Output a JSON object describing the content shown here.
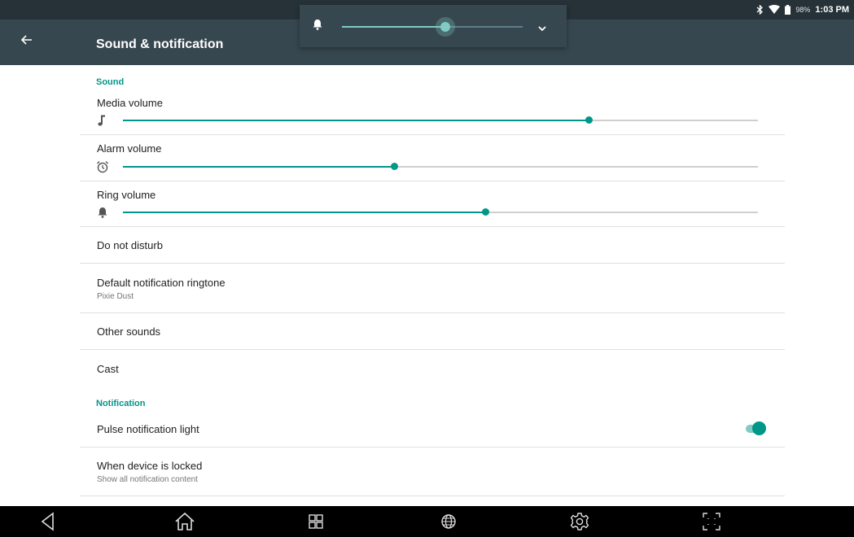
{
  "status_bar": {
    "battery": "98%",
    "time": "1:03 PM",
    "icons": [
      "bluetooth-icon",
      "wifi-icon",
      "battery-icon"
    ]
  },
  "app_bar": {
    "title": "Sound & notification",
    "back_icon": "arrow-left-icon"
  },
  "volume_panel": {
    "icon": "bell-icon",
    "level": 0.57,
    "expand_icon": "chevron-down-icon"
  },
  "sections": {
    "sound": "Sound",
    "notification": "Notification"
  },
  "sliders": [
    {
      "label": "Media volume",
      "icon": "music-note-icon",
      "level": 0.733
    },
    {
      "label": "Alarm volume",
      "icon": "alarm-clock-icon",
      "level": 0.427
    },
    {
      "label": "Ring volume",
      "icon": "bell-icon",
      "level": 0.571
    }
  ],
  "items": {
    "do_not_disturb": {
      "title": "Do not disturb"
    },
    "default_ringtone": {
      "title": "Default notification ringtone",
      "summary": "Pixie Dust"
    },
    "other_sounds": {
      "title": "Other sounds"
    },
    "cast": {
      "title": "Cast"
    },
    "pulse_light": {
      "title": "Pulse notification light",
      "enabled": true
    },
    "device_locked": {
      "title": "When device is locked",
      "summary": "Show all notification content"
    }
  },
  "nav_bar": {
    "buttons": [
      "back-triangle-icon",
      "home-icon",
      "recents-icon",
      "globe-icon",
      "settings-gear-icon",
      "screenshot-frame-icon"
    ]
  },
  "colors": {
    "accent": "#009688",
    "accent_light": "#80cbc4",
    "app_bar": "#37474f",
    "status_bar": "#263238",
    "nav_bar": "#000000"
  }
}
